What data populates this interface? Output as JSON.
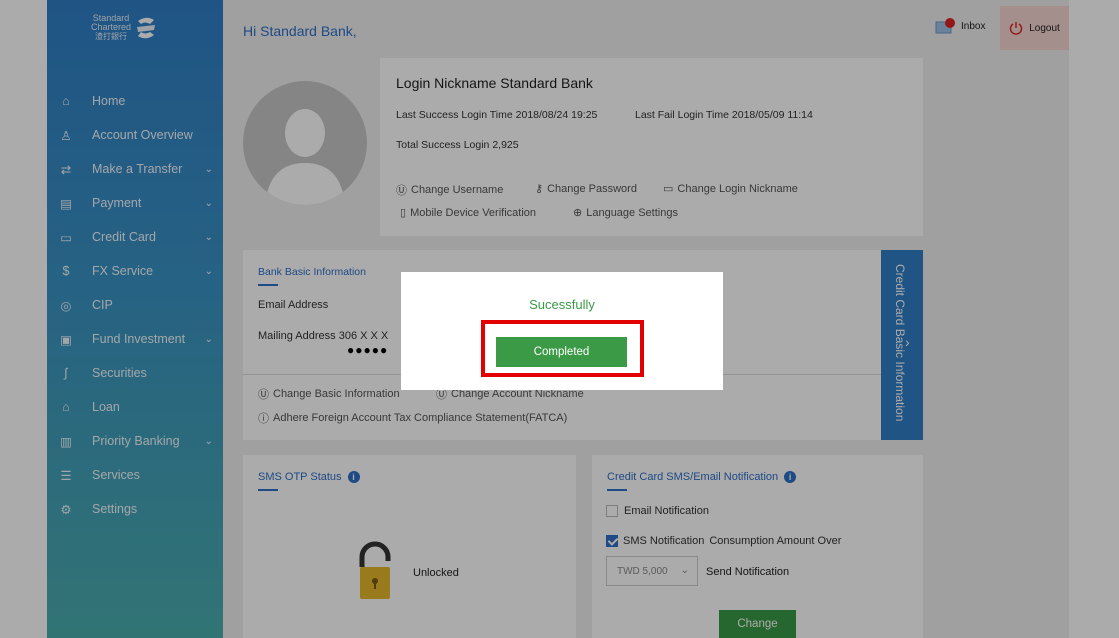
{
  "brand": {
    "line1": "Standard",
    "line2": "Chartered",
    "line3": "渣打銀行"
  },
  "sidebar": {
    "items": [
      {
        "label": "Home",
        "icon": "home-icon",
        "chevron": ""
      },
      {
        "label": "Account Overview",
        "icon": "person-icon",
        "chevron": ""
      },
      {
        "label": "Make a Transfer",
        "icon": "transfer-icon",
        "chevron": "⌄"
      },
      {
        "label": "Payment",
        "icon": "payment-icon",
        "chevron": "⌄"
      },
      {
        "label": "Credit Card",
        "icon": "credit-card-icon",
        "chevron": "⌄"
      },
      {
        "label": "FX Service",
        "icon": "fx-icon",
        "chevron": "⌄"
      },
      {
        "label": "CIP",
        "icon": "cip-icon",
        "chevron": ""
      },
      {
        "label": "Fund Investment",
        "icon": "fund-icon",
        "chevron": "⌄"
      },
      {
        "label": "Securities",
        "icon": "securities-icon",
        "chevron": ""
      },
      {
        "label": "Loan",
        "icon": "loan-icon",
        "chevron": ""
      },
      {
        "label": "Priority Banking",
        "icon": "priority-icon",
        "chevron": "⌄"
      },
      {
        "label": "Services",
        "icon": "services-icon",
        "chevron": ""
      },
      {
        "label": "Settings",
        "icon": "gear-icon",
        "chevron": ""
      }
    ]
  },
  "header": {
    "greeting": "Hi Standard Bank,",
    "inbox": "Inbox",
    "logout": "Logout"
  },
  "profile": {
    "nickname_label": "Login Nickname",
    "nickname": "Standard Bank",
    "last_success_label": "Last Success Login Time",
    "last_success": "2018/08/24 19:25",
    "last_fail_label": "Last Fail Login Time",
    "last_fail": "2018/05/09 11:14",
    "total_label": "Total Success Login",
    "total": "2,925",
    "change_username": "Change Username",
    "change_password": "Change Password",
    "change_nickname": "Change Login Nickname",
    "mobile_verify": "Mobile Device Verification",
    "language": "Language Settings"
  },
  "bank_info": {
    "title": "Bank Basic Information",
    "email_label": "Email Address",
    "mailing_label": "Mailing Address",
    "mailing_value": "306 X X X",
    "masked": "●●●●●",
    "change_basic": "Change Basic Information",
    "change_account_nickname": "Change Account Nickname",
    "fatca": "Adhere Foreign Account Tax Compliance Statement(FATCA)",
    "side_tab": "Credit Card Basic Information"
  },
  "sms_otp": {
    "title": "SMS OTP Status",
    "status": "Unlocked"
  },
  "cc_notify": {
    "title": "Credit Card SMS/Email Notification",
    "email": "Email Notification",
    "sms": "SMS Notification",
    "consumption": "Consumption Amount Over",
    "amount": "TWD 5,000",
    "send": "Send Notification",
    "change": "Change"
  },
  "modal": {
    "message": "Sucessfully",
    "button": "Completed"
  },
  "colors": {
    "brand_blue": "#2e6fc6",
    "success_green": "#3a9a46",
    "highlight_red": "#e30000"
  }
}
